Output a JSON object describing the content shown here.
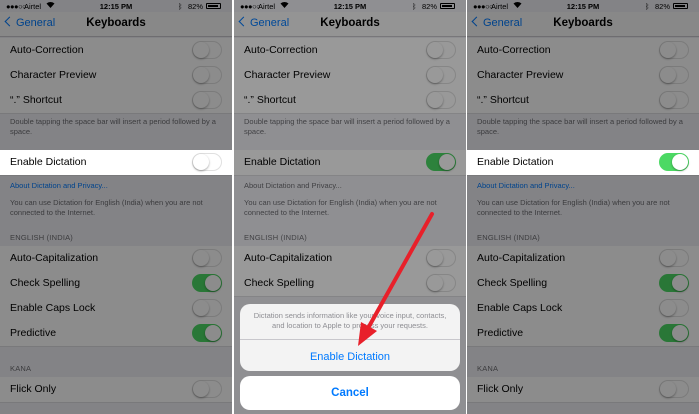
{
  "status": {
    "carrier": "Airtel",
    "time": "12:15 PM",
    "battery": "82%"
  },
  "nav": {
    "back": "General",
    "title": "Keyboards"
  },
  "settings": {
    "auto_correction": "Auto-Correction",
    "character_preview": "Character Preview",
    "shortcut": "“.” Shortcut",
    "shortcut_note": "Double tapping the space bar will insert a period followed by a space.",
    "enable_dictation": "Enable Dictation",
    "about_dictation": "About Dictation and Privacy...",
    "dictation_note": "You can use Dictation for English (India) when you are not connected to the Internet.",
    "section_english": "ENGLISH (INDIA)",
    "auto_capitalization": "Auto-Capitalization",
    "check_spelling": "Check Spelling",
    "enable_caps_lock": "Enable Caps Lock",
    "predictive": "Predictive",
    "section_kana": "KANA",
    "flick_only": "Flick Only"
  },
  "toggles": {
    "panel1": {
      "auto_correction": false,
      "character_preview": false,
      "shortcut": false,
      "enable_dictation": false,
      "auto_capitalization": false,
      "check_spelling": true,
      "enable_caps_lock": false,
      "predictive": true,
      "flick_only": false
    },
    "panel2": {
      "auto_correction": false,
      "character_preview": false,
      "shortcut": false,
      "enable_dictation": true,
      "auto_capitalization": false,
      "check_spelling": false
    },
    "panel3": {
      "auto_correction": false,
      "character_preview": false,
      "shortcut": false,
      "enable_dictation": true,
      "auto_capitalization": false,
      "check_spelling": true,
      "enable_caps_lock": false,
      "predictive": true,
      "flick_only": false
    }
  },
  "action_sheet": {
    "message": "Dictation sends information like your voice input, contacts, and location to Apple to process your requests.",
    "confirm": "Enable Dictation",
    "cancel": "Cancel"
  },
  "colors": {
    "accent": "#007aff",
    "toggle_on": "#4cd964",
    "highlight_arrow": "#e8202a",
    "group_bg": "#efeff4"
  },
  "icons": [
    "chevron-left-icon",
    "wifi-icon",
    "bluetooth-icon",
    "battery-icon",
    "signal-icon",
    "red-arrow-annotation"
  ]
}
